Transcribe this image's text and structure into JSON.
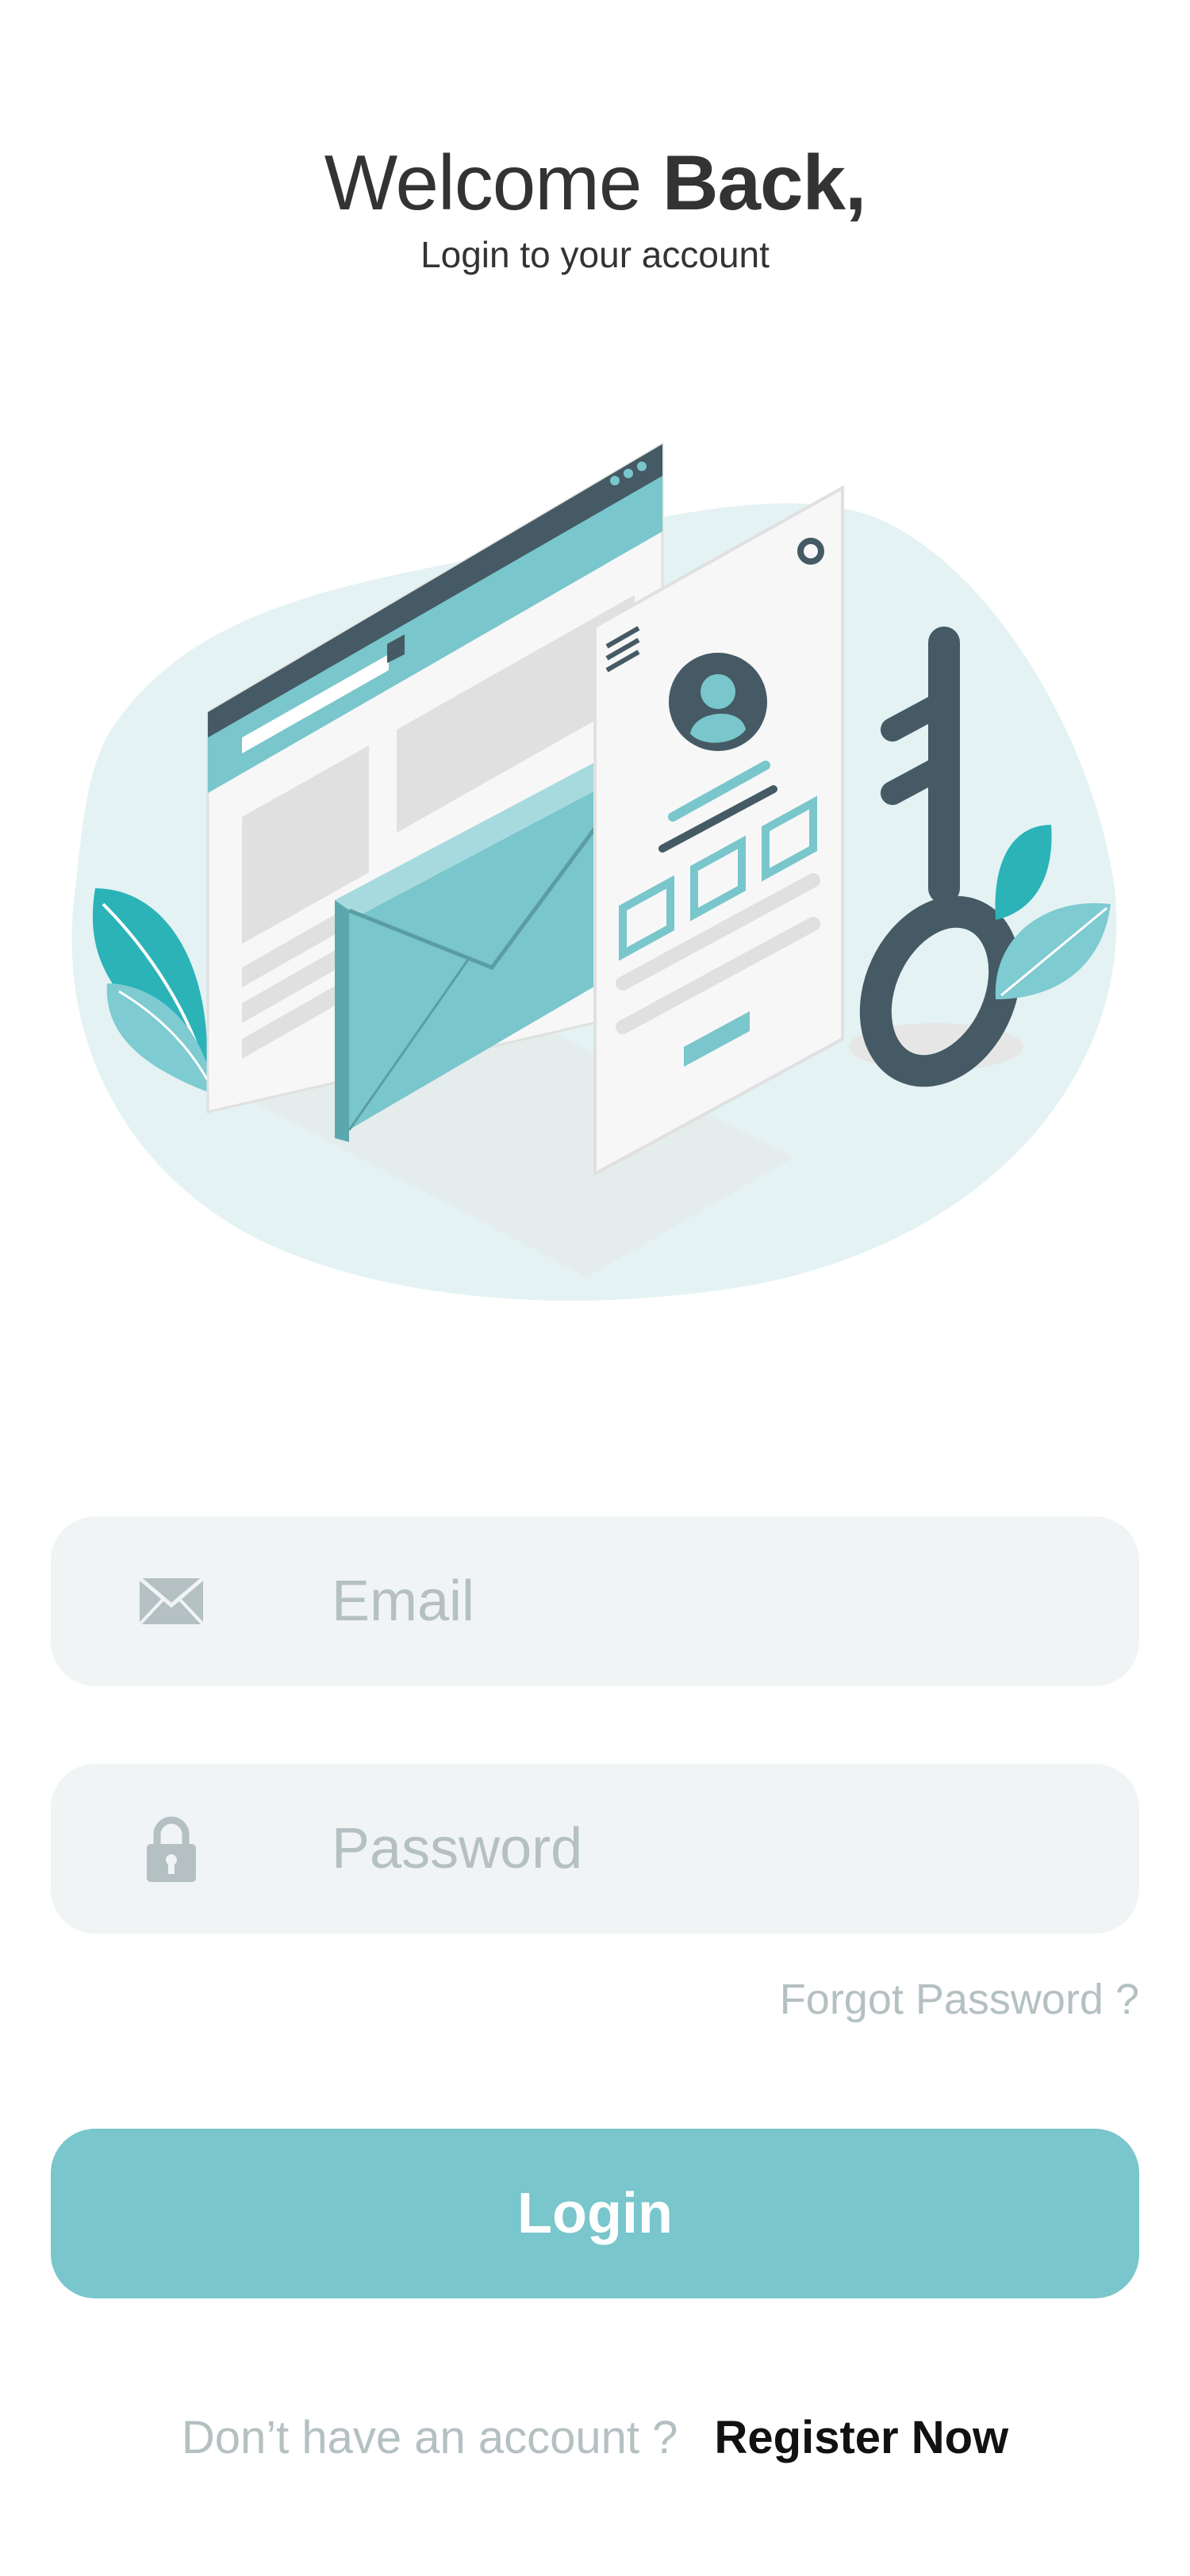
{
  "header": {
    "title_part1": "Welcome",
    "title_part2": "Back,",
    "subtitle": "Login to your account"
  },
  "form": {
    "email": {
      "placeholder": "Email",
      "icon": "envelope-icon"
    },
    "password": {
      "placeholder": "Password",
      "icon": "lock-icon"
    },
    "forgot_password": "Forgot Password ?",
    "login_button": "Login"
  },
  "footer": {
    "question": "Don’t have an account ?",
    "register_link": "Register Now"
  },
  "colors": {
    "accent": "#79c6cc",
    "field_bg": "#f0f4f5",
    "muted_text": "#b4c0c2",
    "dark": "#3f4f59"
  }
}
